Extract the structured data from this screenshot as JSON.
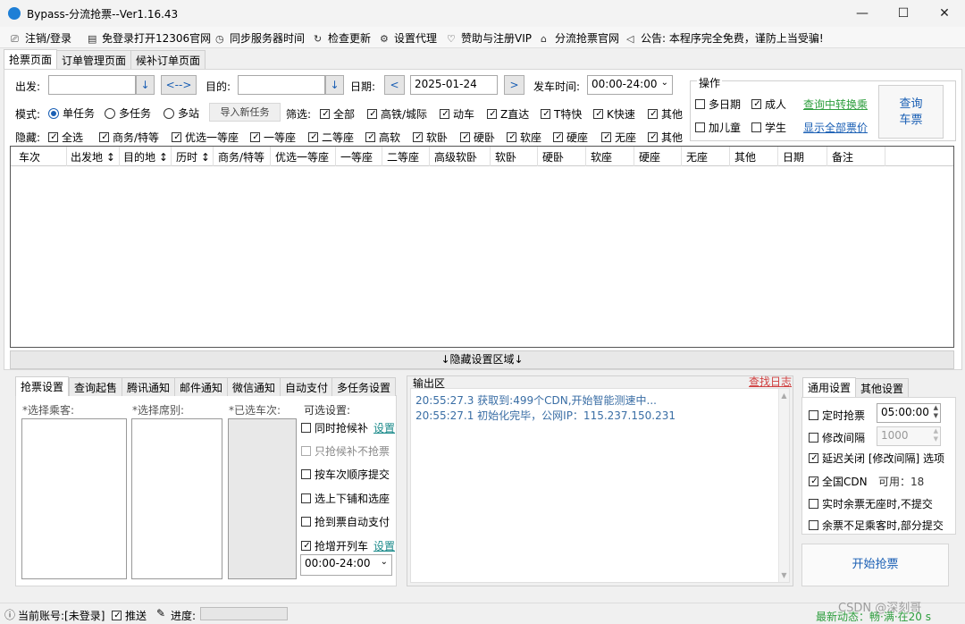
{
  "window": {
    "title": "Bypass-分流抢票--Ver1.16.43",
    "minimize": "—",
    "maximize": "☐",
    "close": "✕"
  },
  "menu": [
    {
      "icon": "logout-icon",
      "glyph": "⎚",
      "label": "注销/登录"
    },
    {
      "icon": "web-icon",
      "glyph": "▤",
      "label": "免登录打开12306官网"
    },
    {
      "icon": "clock-icon",
      "glyph": "◷",
      "label": "同步服务器时间"
    },
    {
      "icon": "refresh-icon",
      "glyph": "↻",
      "label": "检查更新"
    },
    {
      "icon": "gear-icon",
      "glyph": "⚙",
      "label": "设置代理"
    },
    {
      "icon": "heart-icon",
      "glyph": "♡",
      "label": "赞助与注册VIP"
    },
    {
      "icon": "home-icon",
      "glyph": "⌂",
      "label": "分流抢票官网"
    },
    {
      "icon": "speaker-icon",
      "glyph": "◁",
      "label": "公告: 本程序完全免费，谨防上当受骗!"
    }
  ],
  "top_tabs": [
    "抢票页面",
    "订单管理页面",
    "候补订单页面"
  ],
  "query": {
    "from_label": "出发:",
    "from_value": "",
    "from_btn": "↓",
    "swap_btn": "<-->",
    "to_label": "目的:",
    "to_value": "",
    "to_btn": "↓",
    "date_label": "日期:",
    "date_prev": "<",
    "date_value": "2025-01-24",
    "date_next": ">",
    "time_label": "发车时间:",
    "time_value": "00:00-24:00"
  },
  "mode": {
    "label": "模式:",
    "options": [
      "单任务",
      "多任务",
      "多站"
    ],
    "selected": 0,
    "import_btn": "导入新任务"
  },
  "filter": {
    "label": "筛选:",
    "items": [
      {
        "t": "全部",
        "on": true
      },
      {
        "t": "高铁/城际",
        "on": true
      },
      {
        "t": "动车",
        "on": true
      },
      {
        "t": "Z直达",
        "on": true
      },
      {
        "t": "T特快",
        "on": true
      },
      {
        "t": "K快速",
        "on": true
      },
      {
        "t": "其他",
        "on": true
      }
    ]
  },
  "hide": {
    "label": "隐藏:",
    "items": [
      {
        "t": "全选",
        "on": true
      },
      {
        "t": "商务/特等",
        "on": true
      },
      {
        "t": "优选一等座",
        "on": true
      },
      {
        "t": "一等座",
        "on": true
      },
      {
        "t": "二等座",
        "on": true
      },
      {
        "t": "高软",
        "on": true
      },
      {
        "t": "软卧",
        "on": true
      },
      {
        "t": "硬卧",
        "on": true
      },
      {
        "t": "软座",
        "on": true
      },
      {
        "t": "硬座",
        "on": true
      },
      {
        "t": "无座",
        "on": true
      },
      {
        "t": "其他",
        "on": true
      }
    ]
  },
  "ops": {
    "title": "操作",
    "multi_date": "多日期",
    "adult": "成人",
    "adult_on": true,
    "child": "加儿童",
    "student": "学生",
    "transfer_link": "查询中转换乘",
    "show_all_link": "显示全部票价",
    "query_btn_l1": "查询",
    "query_btn_l2": "车票"
  },
  "grid_columns": [
    "车次",
    "出发地 ↕",
    "目的地 ↕",
    "历时 ↕",
    "商务/特等",
    "优选一等座",
    "一等座",
    "二等座",
    "高级软卧",
    "软卧",
    "硬卧",
    "软座",
    "硬座",
    "无座",
    "其他",
    "日期",
    "备注"
  ],
  "hide_settings_bar": "↓隐藏设置区域↓",
  "bottom_tabs": [
    "抢票设置",
    "查询起售",
    "腾讯通知",
    "邮件通知",
    "微信通知",
    "自动支付",
    "多任务设置"
  ],
  "passenger_label": "*选择乘客:",
  "seat_label": "*选择席别:",
  "train_label": "*已选车次:",
  "optional": {
    "title": "可选设置:",
    "items": [
      {
        "t": "同时抢候补",
        "on": false,
        "link": "设置"
      },
      {
        "t": "只抢候补不抢票",
        "on": false,
        "disabled": true
      },
      {
        "t": "按车次顺序提交",
        "on": false
      },
      {
        "t": "选上下铺和选座",
        "on": false
      },
      {
        "t": "抢到票自动支付",
        "on": false
      },
      {
        "t": "抢增开列车",
        "on": true,
        "link": "设置"
      }
    ],
    "time_value": "00:00-24:00"
  },
  "output": {
    "title": "输出区",
    "log_link": "查找日志",
    "lines": [
      "20:55:27.3   获取到:499个CDN,开始智能测速中...",
      "20:55:27.1   初始化完毕，公网IP：115.237.150.231"
    ]
  },
  "settings_tabs": [
    "通用设置",
    "其他设置"
  ],
  "settings": {
    "timed": "定时抢票",
    "timed_value": "05:00:00",
    "interval": "修改间隔",
    "interval_value": "1000",
    "delay_close": "延迟关闭 [修改间隔] 选项",
    "delay_on": true,
    "cdn": "全国CDN",
    "cdn_on": true,
    "cdn_avail": "可用：18",
    "no_seat": "实时余票无座时,不提交",
    "partial": "余票不足乘客时,部分提交",
    "start_btn": "开始抢票"
  },
  "statusbar": {
    "account": "当前账号:[未登录]",
    "push": "推送",
    "push_on": true,
    "progress": "进度:",
    "news": "最新动态：畅·满·在20 s",
    "watermark": "CSDN @深刻哥"
  }
}
